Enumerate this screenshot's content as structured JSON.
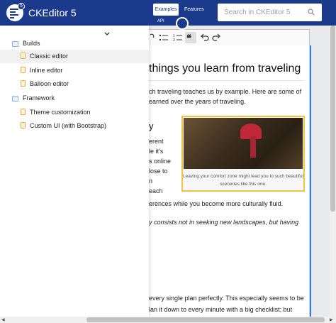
{
  "header": {
    "brand": "CKEditor 5",
    "badge": "5",
    "nav": {
      "examples": "Examples",
      "features": "Features",
      "api": "API"
    },
    "search_placeholder": "Search in CKEditor 5"
  },
  "sidebar": {
    "sections": [
      {
        "label": "Builds",
        "items": [
          "Classic editor",
          "Inline editor",
          "Balloon editor"
        ]
      },
      {
        "label": "Framework",
        "items": [
          "Theme customization",
          "Custom UI (with Bootstrap)"
        ]
      }
    ],
    "active_item": "Classic editor"
  },
  "toolbar": {
    "buttons": [
      "link",
      "bulleted-list",
      "numbered-list",
      "block-quote",
      "undo",
      "redo"
    ],
    "active": "block-quote"
  },
  "content": {
    "heading": "things you learn from traveling",
    "intro_line1": "ch traveling teaches us by example. Here are some of",
    "intro_line2": "earned over the years of traveling.",
    "subheading": "y",
    "para_lines": [
      "erent",
      "le it's",
      "s online",
      "lose to",
      "n",
      "each",
      "erences while you become more culturally fluid."
    ],
    "quote": "y consists not in seeking new landscapes, but having",
    "bottom_line1": " every single plan perfectly. This especially seems to be",
    "bottom_line2": "lan it down to every minute with a big checklist; but",
    "figure_caption": "Leaving your comfort zone might lead you to such beautiful sceneries like this one."
  },
  "colors": {
    "header": "#1b3a8c",
    "focus": "#2977ff",
    "figure_border": "#f0c240"
  }
}
